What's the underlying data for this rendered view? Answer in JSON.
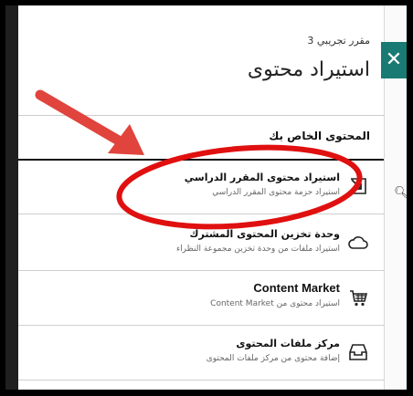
{
  "panel": {
    "subtitle": "مقرر تجريبي 3",
    "title": "استيراد محتوى",
    "close_label": "✕",
    "section_label": "المحتوى الخاص بك"
  },
  "items": [
    {
      "label": "استيراد محتوى المقرر الدراسي",
      "desc": "استيراد حزمة محتوى المقرر الدراسي",
      "icon": "import-arrow-icon"
    },
    {
      "label": "وحدة تخزين المحتوى المشترك",
      "desc": "استيراد ملفات من وحدة تخزين مجموعة النظراء",
      "icon": "cloud-icon"
    },
    {
      "label": "Content Market",
      "desc": "استيراد محتوى من Content Market",
      "icon": "cart-icon"
    },
    {
      "label": "مركز ملفات المحتوى",
      "desc": "إضافة محتوى من مركز ملفات المحتوى",
      "icon": "inbox-tray-icon"
    }
  ],
  "annotation_colors": {
    "arrow": "#e0443c",
    "ellipse": "#e01010"
  }
}
